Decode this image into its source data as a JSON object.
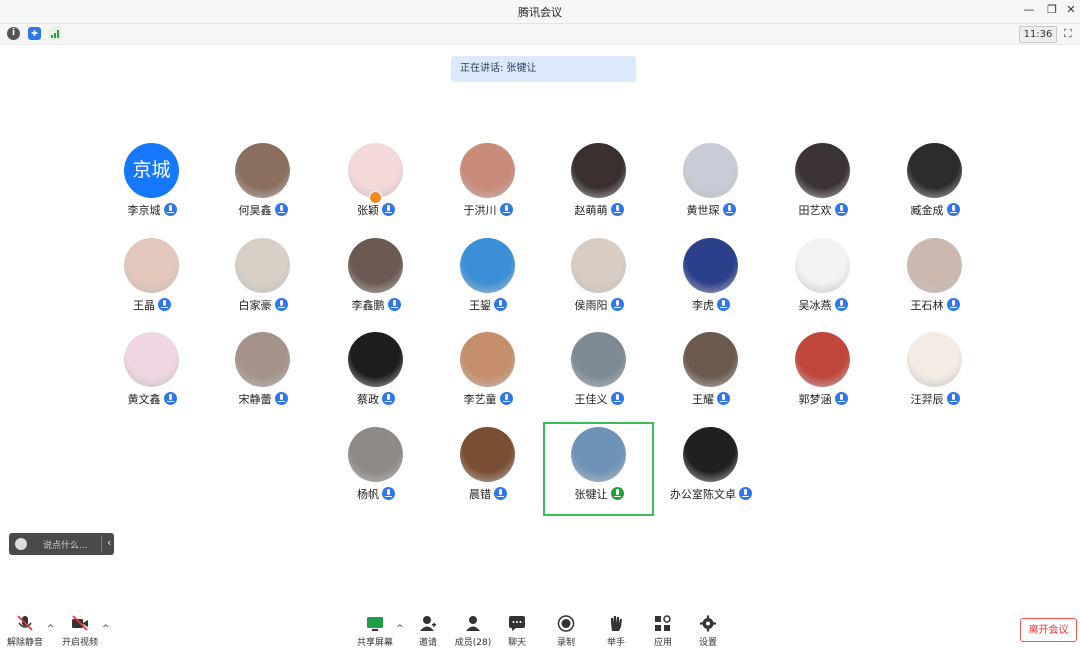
{
  "window": {
    "title": "腾讯会议",
    "min": "—",
    "max": "❐",
    "close": "✕"
  },
  "status": {
    "time": "11:36",
    "info": "i",
    "shield": "✚",
    "fullscreen": "⛶"
  },
  "banner": {
    "speaking": "正在讲话: 张犍让"
  },
  "participants": [
    {
      "name": "李京城",
      "avatar_text": "京城",
      "color": "#1677ff"
    },
    {
      "name": "何昊鑫",
      "color": "#8a6f5e"
    },
    {
      "name": "张颖",
      "color": "#f4d9d9"
    },
    {
      "name": "于洪川",
      "color": "#c98b7a"
    },
    {
      "name": "赵萌萌",
      "color": "#3a3030"
    },
    {
      "name": "黄世琛",
      "color": "#c9cbd6"
    },
    {
      "name": "田艺欢",
      "color": "#3b3334"
    },
    {
      "name": "臧金成",
      "color": "#2c2c2c"
    },
    {
      "name": "王晶",
      "color": "#e3c7bc"
    },
    {
      "name": "白家豪",
      "color": "#d8cfc6"
    },
    {
      "name": "李鑫鹏",
      "color": "#6b5a52"
    },
    {
      "name": "王鋆",
      "color": "#3b8fd6"
    },
    {
      "name": "侯雨阳",
      "color": "#d9ccc2"
    },
    {
      "name": "李虎",
      "color": "#2b3f8a"
    },
    {
      "name": "吴冰燕",
      "color": "#f2f2f2"
    },
    {
      "name": "王石林",
      "color": "#cbb9b0"
    },
    {
      "name": "黄文鑫",
      "color": "#efd6e2"
    },
    {
      "name": "宋静蕾",
      "color": "#a5938a"
    },
    {
      "name": "蔡政",
      "color": "#1e1c1c"
    },
    {
      "name": "李艺童",
      "color": "#c68f6c"
    },
    {
      "name": "王佳义",
      "color": "#7d8a95"
    },
    {
      "name": "王耀",
      "color": "#6c5a4f"
    },
    {
      "name": "郭梦涵",
      "color": "#c0453a"
    },
    {
      "name": "汪羿辰",
      "color": "#f3ece4"
    },
    {
      "name": "杨帆",
      "color": "#8e8a86"
    },
    {
      "name": "晨错",
      "color": "#7a4e32"
    },
    {
      "name": "张犍让",
      "color": "#6f93b7"
    },
    {
      "name": "办公室陈文卓",
      "color": "#202020"
    }
  ],
  "chat": {
    "placeholder": "说点什么...",
    "emoji": "☻",
    "collapse": "‹"
  },
  "toolbar": {
    "unmute": "解除静音",
    "start_video": "开启视频",
    "share_screen": "共享屏幕",
    "invite": "邀请",
    "members": "成员(28)",
    "chat": "聊天",
    "record": "录制",
    "raise_hand": "举手",
    "apps": "应用",
    "settings": "设置",
    "caret": "^",
    "leave": "离开会议"
  },
  "colors": {
    "accent": "#2e77f0",
    "speaking_mic": "#22a03a",
    "active_border": "#37c05a",
    "leave": "#e33333"
  }
}
